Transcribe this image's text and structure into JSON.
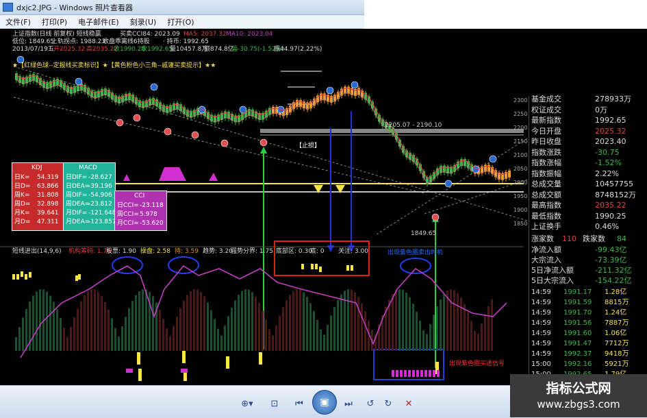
{
  "window": {
    "title": "dxjc2.JPG - Windows 照片查看器"
  },
  "menu": [
    "文件(F)",
    "打印(P)",
    "电子邮件(E)",
    "刻录(U)",
    "打开(O)"
  ],
  "chart": {
    "head1": "上证指数(日线 前复权) 短线稳赢",
    "head1b": "买卖CCI84: 2023.09",
    "ma5": "MA5: 2037.32",
    "ma10": "MA10: 2023.04",
    "head2a": "低位: 1849.65",
    "head2b": "上轨拐点: 1988.23",
    "head2c": "收盘乖离线6持股",
    "head2d": "· 持币: 1992.65",
    "head3a": "2013/07/19五",
    "head3b": "开2025.32",
    "head3c": "高2035.22",
    "head3d": "收1990.25",
    "head3e": "收1992.65",
    "head3f": "量10457.8万",
    "head3g": "额874.8亿",
    "head3h": "幅-30.75(-1.52%)",
    "head3i": "振44.97(2.22%)",
    "tagline": "★【红绿色球--定报线买卖标识】★【黄色粉色小三角--戚蘧买卖提示】★★",
    "range_label": "2205.07 - 2190.10",
    "stop_label": "【止损】",
    "low_label": "1849.65",
    "prices": [
      "2300",
      "2250",
      "2200",
      "2150",
      "2100",
      "2050",
      "2000",
      "1950",
      "1900",
      "1850"
    ],
    "kdj": {
      "title": "KDJ",
      "rows": [
        [
          "日K=",
          "54.319"
        ],
        [
          "日D=",
          "63.866"
        ],
        [
          "周K=",
          "31.808"
        ],
        [
          "周D=",
          "32.898"
        ],
        [
          "月K=",
          "39.641"
        ],
        [
          "月D=",
          "47.311"
        ]
      ]
    },
    "macd": {
      "title": "MACD",
      "rows": [
        [
          "日DIF=",
          "-28.627"
        ],
        [
          "日DEA=",
          "-39.196"
        ],
        [
          "周DIF=",
          "-54.906"
        ],
        [
          "周DEA=",
          "-23.812"
        ],
        [
          "月DIF=",
          "-121.648"
        ],
        [
          "月DEA=",
          "-123.857"
        ]
      ]
    },
    "cci": {
      "title": "CCI",
      "rows": [
        [
          "日CCI=",
          "-23.118"
        ],
        [
          "周CCI=",
          "5.978"
        ],
        [
          "月CCI=",
          "-53.620"
        ]
      ]
    },
    "ind_head": "短线进出(14,9,6)",
    "ind_items": [
      "机构筹码: 1.70",
      "股票: 1.90",
      "操盘: 2.58",
      "持: 3.59",
      "趋势: 3.20",
      "强势分界: 1.75",
      "底部区: 0.30",
      "底: 0",
      "关注: 3.00"
    ],
    "ann_top": "出现紫色圈卖出时机",
    "ann_bottom": "出现紫色圈买进信号",
    "panel": {
      "rows": [
        {
          "label": "基金成交",
          "value": "278933万"
        },
        {
          "label": "权证成交",
          "value": "0万"
        },
        {
          "label": "最新指数",
          "value": "1992.65"
        },
        {
          "label": "今日开盘",
          "value": "2025.32"
        },
        {
          "label": "昨日收盘",
          "value": "2023.40"
        },
        {
          "label": "指数涨跌",
          "value": "-30.75"
        },
        {
          "label": "指数涨幅",
          "value": "-1.52%"
        },
        {
          "label": "指数振幅",
          "value": "2.22%"
        },
        {
          "label": "总成交量",
          "value": "10457755"
        },
        {
          "label": "总成交额",
          "value": "8748152万"
        },
        {
          "label": "最高指数",
          "value": "2035.22"
        },
        {
          "label": "最低指数",
          "value": "1990.25"
        },
        {
          "label": "上证换手",
          "value": "0.46%"
        }
      ],
      "updown": {
        "up_label": "涨家数",
        "up": "110",
        "down_label": "跌家数",
        "down": "84"
      },
      "flows": [
        {
          "label": "净流入额",
          "value": "-99.43亿"
        },
        {
          "label": "大宗流入",
          "value": "-73.39亿"
        },
        {
          "label": "5日净流入额",
          "value": "-211.32亿"
        },
        {
          "label": "5日大宗流入",
          "value": "-154.22亿"
        }
      ],
      "ticks": [
        [
          "14:59",
          "1991.17",
          "1.28亿"
        ],
        [
          "14:59",
          "1991.59",
          "8815万"
        ],
        [
          "14:59",
          "1991.70",
          "1.24亿"
        ],
        [
          "14:59",
          "1991.56",
          "7887万"
        ],
        [
          "14:59",
          "1991.60",
          "1.06亿"
        ],
        [
          "14:59",
          "1991.47",
          "7712万"
        ],
        [
          "14:59",
          "1992.37",
          "9418万"
        ],
        [
          "15:00",
          "1992.16",
          "5921万"
        ],
        [
          "15:00",
          "1992.65",
          "1.79亿"
        ]
      ]
    }
  },
  "bottom": {
    "zoom": "⊕▾",
    "fit": "⊡",
    "prev": "⏮",
    "slideshow": "▣",
    "next": "⏭",
    "rotl": "↺",
    "rotr": "↻",
    "del": "✕"
  },
  "watermark": {
    "line1": "指标公式网",
    "line2": "www.zbgs3.com"
  },
  "colors": {
    "up": "#f0a030",
    "down": "#3cb84a",
    "ma": "#e04040",
    "purple": "#c040c0",
    "yellow": "#f7e34a"
  }
}
